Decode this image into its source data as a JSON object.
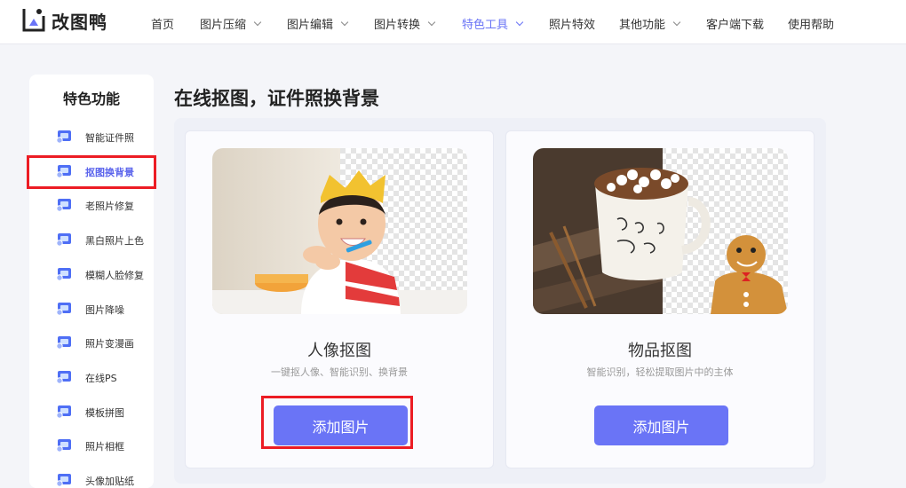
{
  "brand": {
    "name": "改图鸭"
  },
  "nav": {
    "items": [
      {
        "label": "首页",
        "dropdown": false,
        "active": false
      },
      {
        "label": "图片压缩",
        "dropdown": true,
        "active": false
      },
      {
        "label": "图片编辑",
        "dropdown": true,
        "active": false
      },
      {
        "label": "图片转换",
        "dropdown": true,
        "active": false
      },
      {
        "label": "特色工具",
        "dropdown": true,
        "active": true
      },
      {
        "label": "照片特效",
        "dropdown": false,
        "active": false
      },
      {
        "label": "其他功能",
        "dropdown": true,
        "active": false
      },
      {
        "label": "客户端下载",
        "dropdown": false,
        "active": false
      },
      {
        "label": "使用帮助",
        "dropdown": false,
        "active": false
      }
    ]
  },
  "sidebar": {
    "title": "特色功能",
    "items": [
      {
        "label": "智能证件照",
        "icon": "id-photo-icon",
        "active": false
      },
      {
        "label": "抠图换背景",
        "icon": "cutout-icon",
        "active": true
      },
      {
        "label": "老照片修复",
        "icon": "photo-repair-icon",
        "active": false
      },
      {
        "label": "黑白照片上色",
        "icon": "colorize-icon",
        "active": false
      },
      {
        "label": "模糊人脸修复",
        "icon": "face-repair-icon",
        "active": false
      },
      {
        "label": "图片降噪",
        "icon": "denoise-icon",
        "active": false
      },
      {
        "label": "照片变漫画",
        "icon": "cartoon-icon",
        "active": false
      },
      {
        "label": "在线PS",
        "icon": "ps-icon",
        "active": false
      },
      {
        "label": "模板拼图",
        "icon": "collage-icon",
        "active": false
      },
      {
        "label": "照片相框",
        "icon": "frame-icon",
        "active": false
      },
      {
        "label": "头像加贴纸",
        "icon": "sticker-icon",
        "active": false
      }
    ]
  },
  "main": {
    "title": "在线抠图，证件照换背景",
    "cards": [
      {
        "title": "人像抠图",
        "subtitle": "一键抠人像、智能识别、换背景",
        "button": "添加图片",
        "image": "portrait-cutout-image"
      },
      {
        "title": "物品抠图",
        "subtitle": "智能识别，轻松提取图片中的主体",
        "button": "添加图片",
        "image": "object-cutout-image"
      }
    ]
  },
  "theme": {
    "accent": "#6a74f6",
    "highlight": "#ec1c24"
  }
}
